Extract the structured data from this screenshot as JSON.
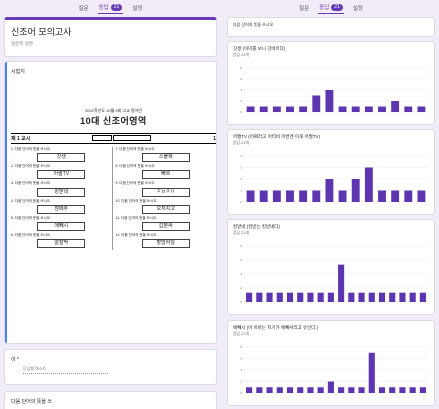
{
  "tabs": [
    {
      "label": "질문"
    },
    {
      "label": "응답",
      "badge": "21"
    },
    {
      "label": "설정"
    }
  ],
  "form": {
    "title": "신조어 모의고사",
    "description": "설문지 설명"
  },
  "exam_question": "시험지",
  "exam": {
    "header_small": "2021학년도 10월 9회 고교 원어민",
    "header_big": "10대 신조어영역",
    "section": "제 1 교시",
    "colA": [
      {
        "q": "1. 다음 단어의 뜻을 쓰시오.",
        "a": "갓생"
      },
      {
        "q": "2. 다음 단어의 뜻을 쓰시오.",
        "a": "어쩔TV"
      },
      {
        "q": "3. 다음 단어의 뜻을 쓰시오.",
        "a": "킹받네"
      },
      {
        "q": "4. 다음 단어의 뜻을 쓰시오.",
        "a": "점메추"
      },
      {
        "q": "5. 다음 단어의 뜻을 쓰시오.",
        "a": "애빼시"
      },
      {
        "q": "6. 다음 단어의 뜻을 쓰시오.",
        "a": "알잘딱"
      }
    ],
    "colB": [
      {
        "q": "7. 다음 단어의 뜻을 쓰시오.",
        "a": "스불재"
      },
      {
        "q": "8. 다음 단어의 뜻을 쓰시오.",
        "a": "뻐르"
      },
      {
        "q": "9. 다음 단어의 뜻을 쓰시오.",
        "a": "ㅈㅂㅈㅇ"
      },
      {
        "q": "10. 다음 단어의 뜻을 쓰시오.",
        "a": "오저치고"
      },
      {
        "q": "11. 다음 단어의 뜻을 쓰시오.",
        "a": "갑분싸"
      },
      {
        "q": "12. 다음 단어의 뜻을 쓰시오.",
        "a": "할많하않"
      }
    ]
  },
  "name_field": {
    "label": "이 *",
    "placeholder": "단답형 텍스트"
  },
  "next_question": "다음 단어의 뜻을 쓰",
  "right": {
    "prompt": "다음 단어의 뜻을 쓰시오.",
    "cards": [
      {
        "title": "갓생 (이미를 보니 갓바르다)",
        "count": "응답 21개"
      },
      {
        "title": "어쩔TV (어쩌라고 어티비 이번엔 이게 어쩔TV)",
        "count": "응답 21개"
      },
      {
        "title": "킹받네 (킹받는 킹받네다)",
        "count": "응답 21개"
      },
      {
        "title": "애빼시 (이 이바는 지기가 애빼서리고 유인다.)",
        "count": "응답 21개"
      }
    ]
  },
  "chart_data": [
    {
      "type": "bar",
      "values": [
        1,
        1,
        1,
        1,
        1,
        3,
        4,
        1,
        1,
        1,
        1,
        2,
        1,
        1
      ],
      "ylim": [
        0,
        8
      ]
    },
    {
      "type": "bar",
      "values": [
        1,
        1,
        1,
        1,
        1,
        1,
        2,
        1,
        2,
        3,
        1,
        1,
        1,
        1
      ],
      "ylim": [
        0,
        4
      ]
    },
    {
      "type": "bar",
      "values": [
        1,
        1,
        1,
        1,
        1,
        1,
        1,
        1,
        1,
        4,
        1,
        1,
        1,
        1,
        1,
        1,
        1,
        1
      ],
      "ylim": [
        0,
        6
      ]
    },
    {
      "type": "bar",
      "values": [
        1,
        1,
        1,
        1,
        1,
        1,
        1,
        1,
        2,
        1,
        1,
        1,
        7,
        1,
        1,
        1,
        1,
        1
      ],
      "ylim": [
        0,
        8
      ]
    }
  ],
  "colors": {
    "accent": "#673ab7",
    "bar": "#5e35b1",
    "bg": "#f1ecf7",
    "edge": "#4285f4"
  }
}
